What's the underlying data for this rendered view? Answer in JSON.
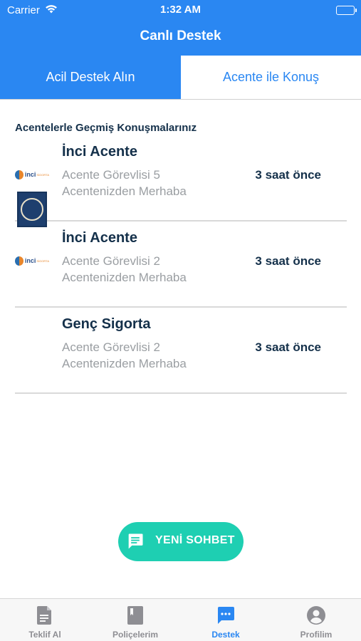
{
  "status_bar": {
    "carrier": "Carrier",
    "time": "1:32 AM"
  },
  "nav": {
    "title": "Canlı Destek"
  },
  "tabs": {
    "left": "Acil Destek Alın",
    "right": "Acente ile Konuş"
  },
  "section_title": "Acentelerle Geçmiş Konuşmalarınız",
  "conversations": [
    {
      "name": "İnci Acente",
      "agent": "Acente Görevlisi 5",
      "message": "Acentenizden Merhaba",
      "time": "3 saat önce",
      "logo": "inci-logo"
    },
    {
      "name": "İnci Acente",
      "agent": "Acente Görevlisi 2",
      "message": "Acentenizden Merhaba",
      "time": "3 saat önce",
      "logo": "inci-logo"
    },
    {
      "name": "Genç Sigorta",
      "agent": "Acente Görevlisi 2",
      "message": "Acentenizden Merhaba",
      "time": "3 saat önce",
      "logo": "genc-sigorta-logo"
    }
  ],
  "logo_text": {
    "inci": "inci",
    "inci_sub": "SİGORTA"
  },
  "fab": {
    "label": "YENİ SOHBET",
    "icon": "chat-icon"
  },
  "tab_bar": {
    "items": [
      {
        "label": "Teklif Al",
        "icon": "document-icon"
      },
      {
        "label": "Poliçelerim",
        "icon": "book-icon"
      },
      {
        "label": "Destek",
        "icon": "chat-icon"
      },
      {
        "label": "Profilim",
        "icon": "profile-icon"
      }
    ],
    "active_index": 2
  },
  "colors": {
    "brand": "#2a87f2",
    "accent": "#1ecfb2",
    "text_dark": "#14304a",
    "text_muted": "#9a9ea2"
  }
}
